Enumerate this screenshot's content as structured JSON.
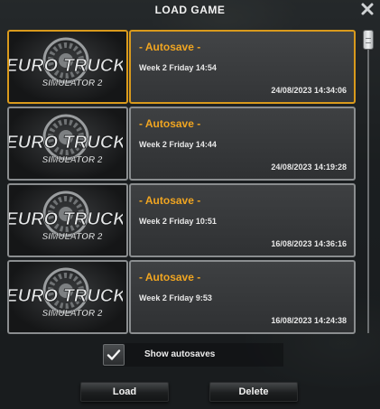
{
  "window": {
    "title": "LOAD GAME",
    "close_icon": "close-icon"
  },
  "saves": [
    {
      "title": "- Autosave -",
      "game_time": "Week 2  Friday 14:54",
      "saved_at": "24/08/2023  14:34:06",
      "selected": true,
      "logo_line1": "EURO TRUCK",
      "logo_line2": "SIMULATOR 2"
    },
    {
      "title": "- Autosave -",
      "game_time": "Week 2  Friday 14:44",
      "saved_at": "24/08/2023  14:19:28",
      "selected": false,
      "logo_line1": "EURO TRUCK",
      "logo_line2": "SIMULATOR 2"
    },
    {
      "title": "- Autosave -",
      "game_time": "Week 2  Friday 10:51",
      "saved_at": "16/08/2023  14:36:16",
      "selected": false,
      "logo_line1": "EURO TRUCK",
      "logo_line2": "SIMULATOR 2"
    },
    {
      "title": "- Autosave -",
      "game_time": "Week 2  Friday 9:53",
      "saved_at": "16/08/2023  14:24:38",
      "selected": false,
      "logo_line1": "EURO TRUCK",
      "logo_line2": "SIMULATOR 2"
    }
  ],
  "options": {
    "show_autosaves_label": "Show autosaves",
    "show_autosaves_checked": true,
    "checkbox_icon": "checkmark-icon"
  },
  "buttons": {
    "load_label": "Load",
    "delete_label": "Delete"
  },
  "colors": {
    "accent": "#f0a521",
    "selected_border": "#d99a1c",
    "border": "#8a8d8f"
  }
}
